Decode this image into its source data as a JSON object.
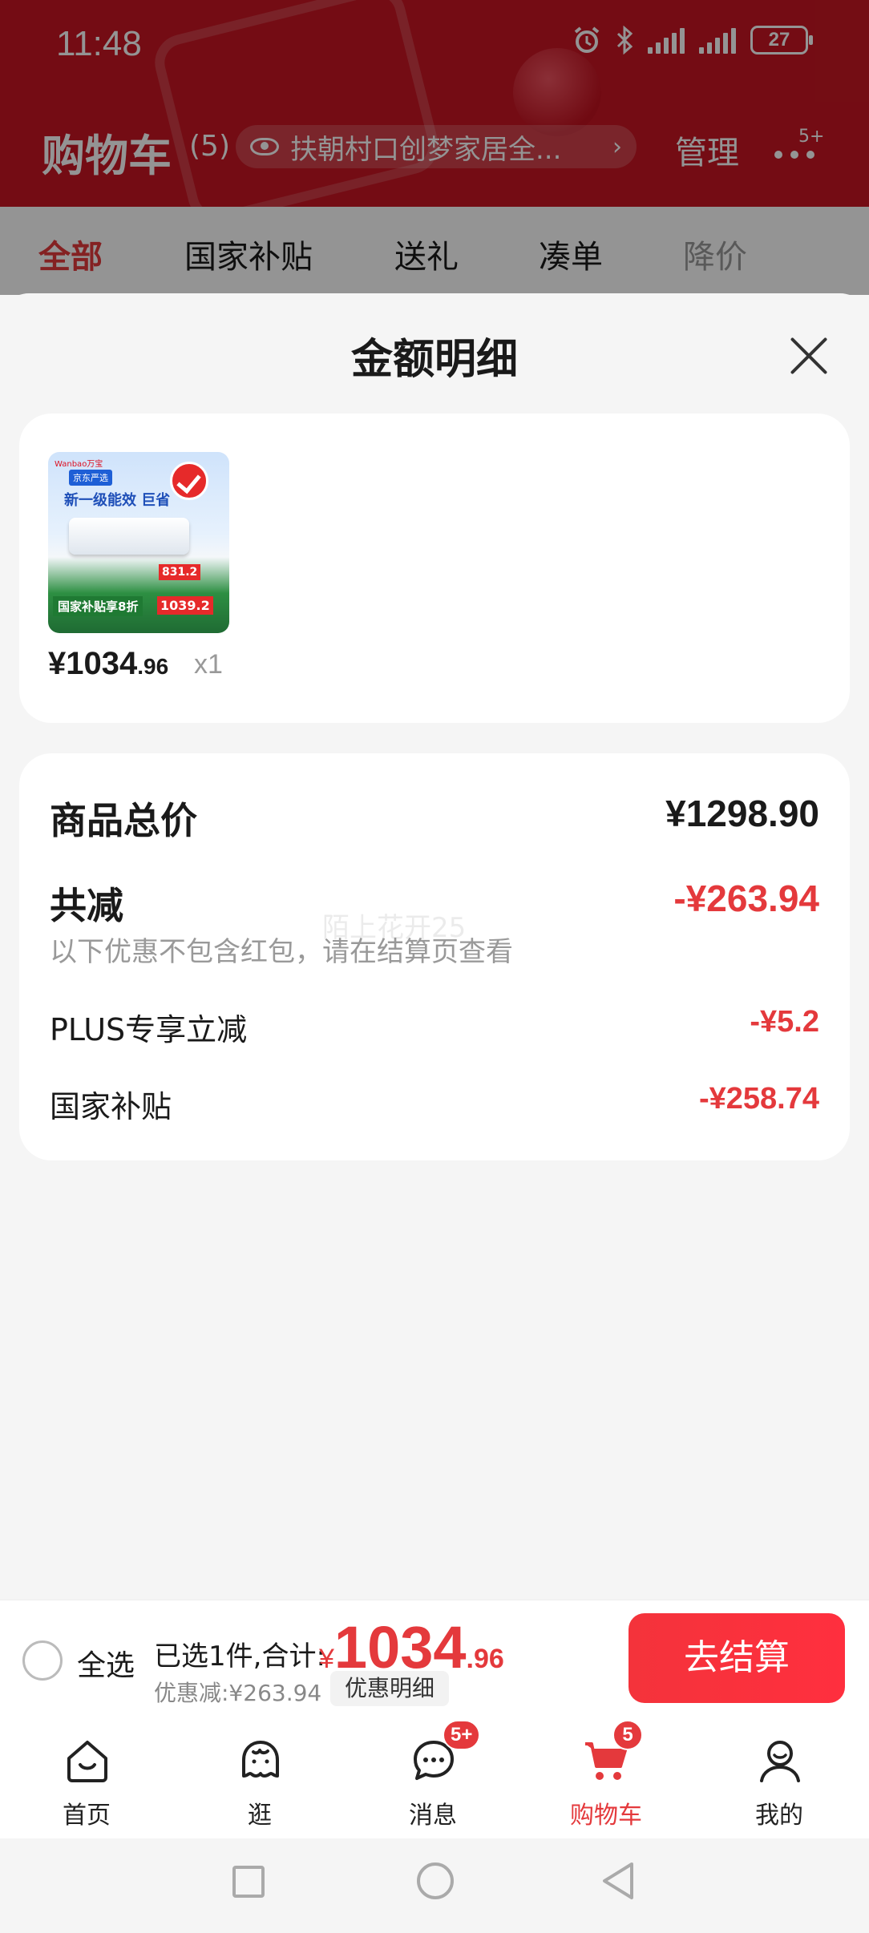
{
  "status_bar": {
    "time": "11:48",
    "battery": "27"
  },
  "header": {
    "title": "购物车",
    "count": "(5)",
    "address": "扶朝村口创梦家居全...",
    "manage": "管理",
    "more_badge": "5+"
  },
  "tabs": [
    "全部",
    "国家补贴",
    "送礼",
    "凑单",
    "降价"
  ],
  "sheet": {
    "title": "金额明细",
    "item": {
      "thumb_brand": "Wanbao万宝",
      "thumb_headline1": "京东严选",
      "thumb_headline2": "新一级能效 巨省",
      "thumb_price": "831.2",
      "thumb_gov": "国家补贴享8折",
      "thumb_low": "1039.2",
      "price_int": "¥1034",
      "price_frac": ".96",
      "qty": "x1"
    },
    "summary": {
      "total_label": "商品总价",
      "total_value": "¥1298.90",
      "discount_label": "共减",
      "discount_value": "-¥263.94",
      "note": "以下优惠不包含红包，请在结算页查看",
      "watermark": "陌上花开25",
      "items": [
        {
          "label": "PLUS专享立减",
          "value": "-¥5.2"
        },
        {
          "label": "国家补贴",
          "value": "-¥258.74"
        }
      ]
    }
  },
  "checkout": {
    "select_all": "全选",
    "selected_info": "已选1件,合计:",
    "currency": "¥",
    "total_int": "1034",
    "total_frac": ".96",
    "saved": "优惠减:¥263.94",
    "detail_button": "优惠明细",
    "pay_button": "去结算"
  },
  "nav": {
    "items": [
      {
        "label": "首页",
        "icon": "home-icon"
      },
      {
        "label": "逛",
        "icon": "browse-icon"
      },
      {
        "label": "消息",
        "icon": "message-icon",
        "badge": "5+"
      },
      {
        "label": "购物车",
        "icon": "cart-icon",
        "badge": "5"
      },
      {
        "label": "我的",
        "icon": "profile-icon"
      }
    ]
  },
  "colors": {
    "accent": "#e4393c",
    "header_bg": "#c81623",
    "pay_button": "#f4333b"
  }
}
